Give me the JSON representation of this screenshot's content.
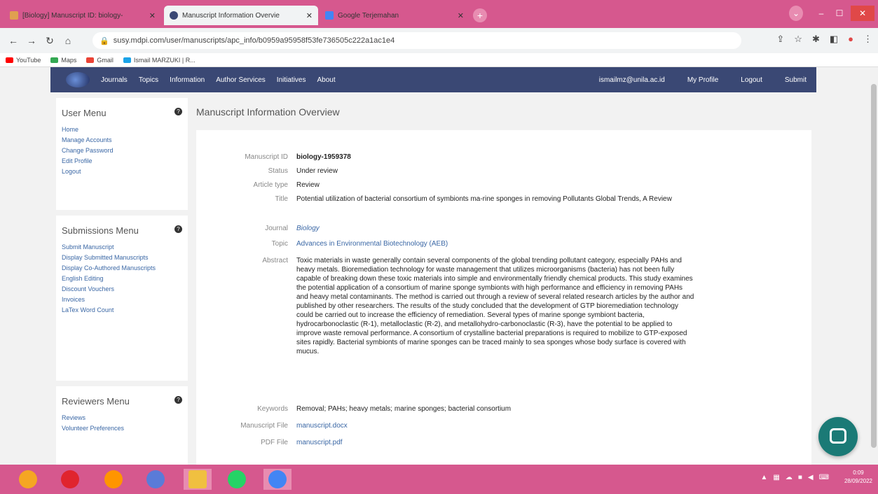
{
  "browser": {
    "tabs": [
      {
        "label": "[Biology] Manuscript ID: biology-"
      },
      {
        "label": "Manuscript Information Overvie"
      },
      {
        "label": "Google Terjemahan"
      }
    ],
    "new_tab": "+",
    "url": "susy.mdpi.com/user/manuscripts/apc_info/b0959a95958f53fe736505c222a1ac1e4",
    "bookmarks": [
      {
        "label": "YouTube",
        "color": "#ff0000"
      },
      {
        "label": "Maps",
        "color": "#34a853"
      },
      {
        "label": "Gmail",
        "color": "#ea4335"
      },
      {
        "label": "Ismail MARZUKI | R...",
        "color": "#1aa3e8"
      }
    ]
  },
  "topnav": {
    "items": [
      "Journals",
      "Topics",
      "Information",
      "Author Services",
      "Initiatives",
      "About"
    ],
    "right": [
      "ismailmz@unila.ac.id",
      "My Profile",
      "Logout",
      "Submit"
    ]
  },
  "sidebar": {
    "user_menu": {
      "title": "User Menu",
      "items": [
        "Home",
        "Manage Accounts",
        "Change Password",
        "Edit Profile",
        "Logout"
      ]
    },
    "submissions_menu": {
      "title": "Submissions Menu",
      "items": [
        "Submit Manuscript",
        "Display Submitted Manuscripts",
        "Display Co-Authored Manuscripts",
        "English Editing",
        "Discount Vouchers",
        "Invoices",
        "LaTex Word Count"
      ]
    },
    "reviewers_menu": {
      "title": "Reviewers Menu",
      "items": [
        "Reviews",
        "Volunteer Preferences"
      ]
    }
  },
  "main": {
    "title": "Manuscript Information Overview",
    "fields": {
      "manuscript_id": {
        "label": "Manuscript ID",
        "value": "biology-1959378"
      },
      "status": {
        "label": "Status",
        "value": "Under review"
      },
      "article_type": {
        "label": "Article type",
        "value": "Review"
      },
      "title": {
        "label": "Title",
        "value": "Potential utilization of bacterial consortium of symbionts ma-rine sponges in removing Pollutants Global Trends, A Review"
      },
      "journal": {
        "label": "Journal",
        "value": "Biology"
      },
      "topic": {
        "label": "Topic",
        "value": "Advances in Environmental Biotechnology (AEB)"
      },
      "abstract": {
        "label": "Abstract",
        "value": "Toxic materials in waste generally contain several components of the global trending pollutant category, especially PAHs and heavy metals. Bioremediation technology for waste management that utilizes microorganisms (bacteria) has not been fully capable of breaking down these toxic materials into simple and environmentally friendly chemical products. This study examines the potential application of a consortium of marine sponge symbionts with high performance and efficiency in removing PAHs and heavy metal contaminants. The method is carried out through a review of several related research articles by the author and published by other researchers. The results of the study concluded that the development of GTP bioremediation technology could be carried out to increase the efficiency of remediation. Several types of marine sponge symbiont bacteria, hydrocarbonoclastic (R-1), metalloclastic (R-2), and metallohydro-carbonoclastic (R-3), have the potential to be applied to improve waste removal performance. A consortium of crystalline bacterial preparations is required to mobilize to GTP-exposed sites rapidly. Bacterial symbionts of marine sponges can be traced mainly to sea sponges whose body surface is covered with mucus."
      },
      "keywords": {
        "label": "Keywords",
        "value": "Removal; PAHs; heavy metals; marine sponges; bacterial consortium"
      },
      "manuscript_file": {
        "label": "Manuscript File",
        "value": "manuscript.docx"
      },
      "pdf_file": {
        "label": "PDF File",
        "value": "manuscript.pdf"
      }
    }
  },
  "taskbar": {
    "clock_time": "0:09",
    "clock_date": "28/09/2022"
  }
}
